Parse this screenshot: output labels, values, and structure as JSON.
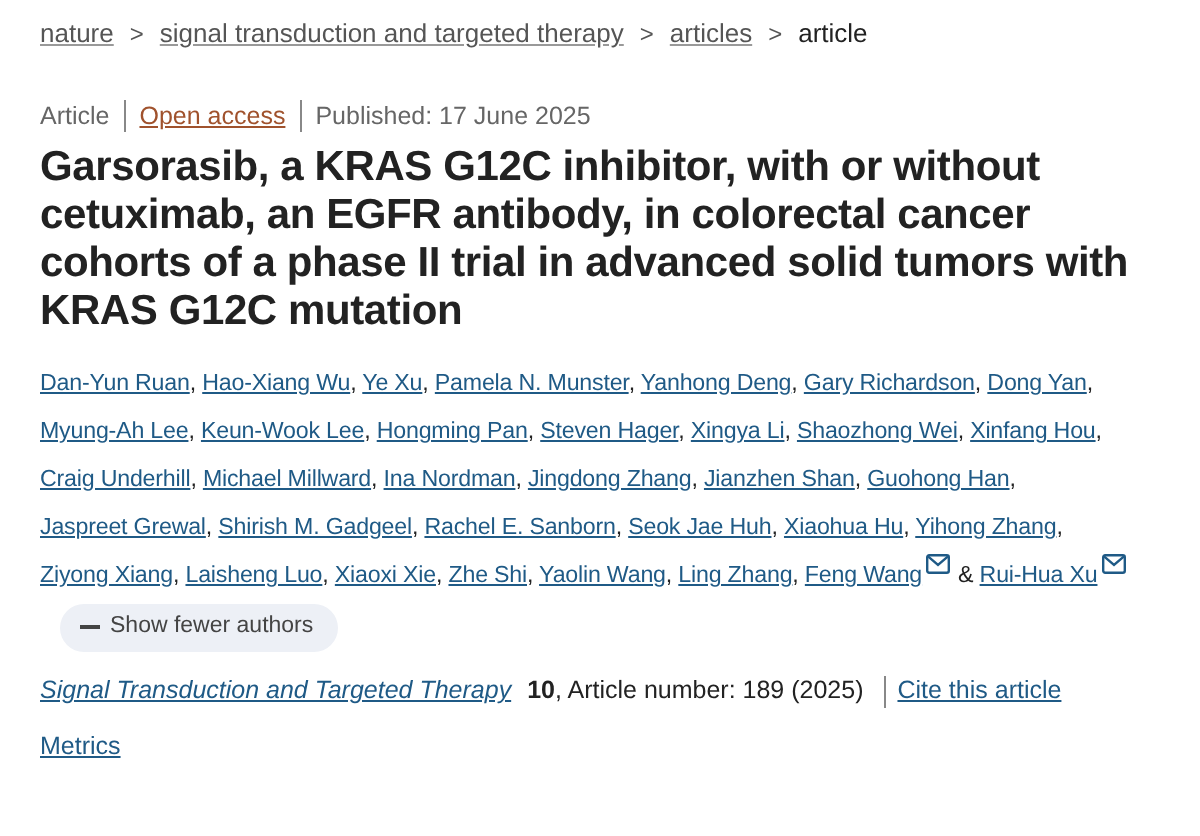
{
  "breadcrumb": [
    {
      "label": "nature",
      "kind": "link"
    },
    {
      "label": "signal transduction and targeted therapy",
      "kind": "link"
    },
    {
      "label": "articles",
      "kind": "link"
    },
    {
      "label": "article",
      "kind": "current"
    }
  ],
  "separator_glyph": ">",
  "meta": {
    "type": "Article",
    "access": "Open access",
    "published": "Published: 17 June 2025"
  },
  "title": "Garsorasib, a KRAS G12C inhibitor, with or without cetuximab, an EGFR antibody, in colorectal cancer cohorts of a phase II trial in advanced solid tumors with KRAS G12C mutation",
  "authors": [
    {
      "name": "Dan-Yun Ruan",
      "email": false,
      "separator": ","
    },
    {
      "name": "Hao-Xiang Wu",
      "email": false,
      "separator": ","
    },
    {
      "name": "Ye Xu",
      "email": false,
      "separator": ","
    },
    {
      "name": "Pamela N. Munster",
      "email": false,
      "separator": ","
    },
    {
      "name": "Yanhong Deng",
      "email": false,
      "separator": ","
    },
    {
      "name": "Gary Richardson",
      "email": false,
      "separator": ","
    },
    {
      "name": "Dong Yan",
      "email": false,
      "separator": ","
    },
    {
      "name": "Myung-Ah Lee",
      "email": false,
      "separator": ","
    },
    {
      "name": "Keun-Wook Lee",
      "email": false,
      "separator": ","
    },
    {
      "name": "Hongming Pan",
      "email": false,
      "separator": ","
    },
    {
      "name": "Steven Hager",
      "email": false,
      "separator": ","
    },
    {
      "name": "Xingya Li",
      "email": false,
      "separator": ","
    },
    {
      "name": "Shaozhong Wei",
      "email": false,
      "separator": ","
    },
    {
      "name": "Xinfang Hou",
      "email": false,
      "separator": ","
    },
    {
      "name": "Craig Underhill",
      "email": false,
      "separator": ","
    },
    {
      "name": "Michael Millward",
      "email": false,
      "separator": ","
    },
    {
      "name": "Ina Nordman",
      "email": false,
      "separator": ","
    },
    {
      "name": "Jingdong Zhang",
      "email": false,
      "separator": ","
    },
    {
      "name": "Jianzhen Shan",
      "email": false,
      "separator": ","
    },
    {
      "name": "Guohong Han",
      "email": false,
      "separator": ","
    },
    {
      "name": "Jaspreet Grewal",
      "email": false,
      "separator": ","
    },
    {
      "name": "Shirish M. Gadgeel",
      "email": false,
      "separator": ","
    },
    {
      "name": "Rachel E. Sanborn",
      "email": false,
      "separator": ","
    },
    {
      "name": "Seok Jae Huh",
      "email": false,
      "separator": ","
    },
    {
      "name": "Xiaohua Hu",
      "email": false,
      "separator": ","
    },
    {
      "name": "Yihong Zhang",
      "email": false,
      "separator": ","
    },
    {
      "name": "Ziyong Xiang",
      "email": false,
      "separator": ","
    },
    {
      "name": "Laisheng Luo",
      "email": false,
      "separator": ","
    },
    {
      "name": "Xiaoxi Xie",
      "email": false,
      "separator": ","
    },
    {
      "name": "Zhe Shi",
      "email": false,
      "separator": ","
    },
    {
      "name": "Yaolin Wang",
      "email": false,
      "separator": ","
    },
    {
      "name": "Ling Zhang",
      "email": false,
      "separator": ","
    },
    {
      "name": "Feng Wang",
      "email": true,
      "separator": "&"
    },
    {
      "name": "Rui-Hua Xu",
      "email": true
    }
  ],
  "show_fewer_button": "Show fewer authors",
  "citation": {
    "journal": "Signal Transduction and Targeted Therapy",
    "details": "**10**, Article number: 189 (2025)",
    "cite_link": "Cite this article"
  },
  "metrics_link": "Metrics"
}
